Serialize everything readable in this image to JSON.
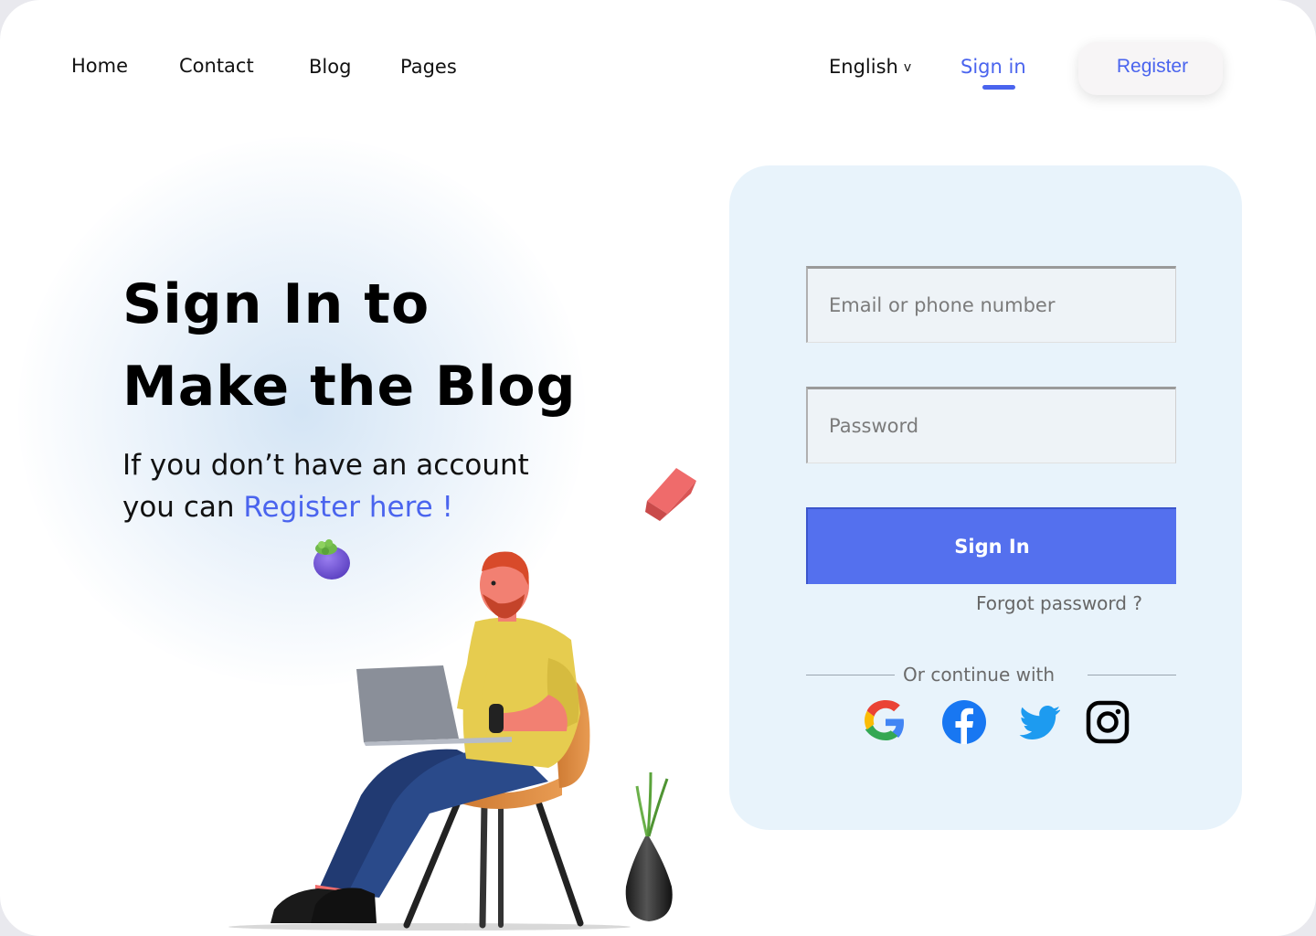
{
  "nav": {
    "links": [
      "Home",
      "Contact",
      "Blog",
      "Pages"
    ],
    "language": "English",
    "language_chevron": "v",
    "signin": "Sign in",
    "register": "Register"
  },
  "hero": {
    "title_line1": "Sign In to",
    "title_line2": "Make the Blog",
    "sub_line1": "If you don’t have an account",
    "sub_line2_prefix": "you can ",
    "register_link": "Register here !"
  },
  "form": {
    "email_placeholder": "Email or phone number",
    "password_placeholder": "Password",
    "submit_label": "Sign In",
    "forgot": "Forgot password ?",
    "divider_text": "Or continue with",
    "social": [
      "google-icon",
      "facebook-icon",
      "twitter-icon",
      "instagram-icon"
    ]
  },
  "colors": {
    "accent": "#4a64ee",
    "button": "#5470ee",
    "card_bg": "#e8f3fb"
  }
}
